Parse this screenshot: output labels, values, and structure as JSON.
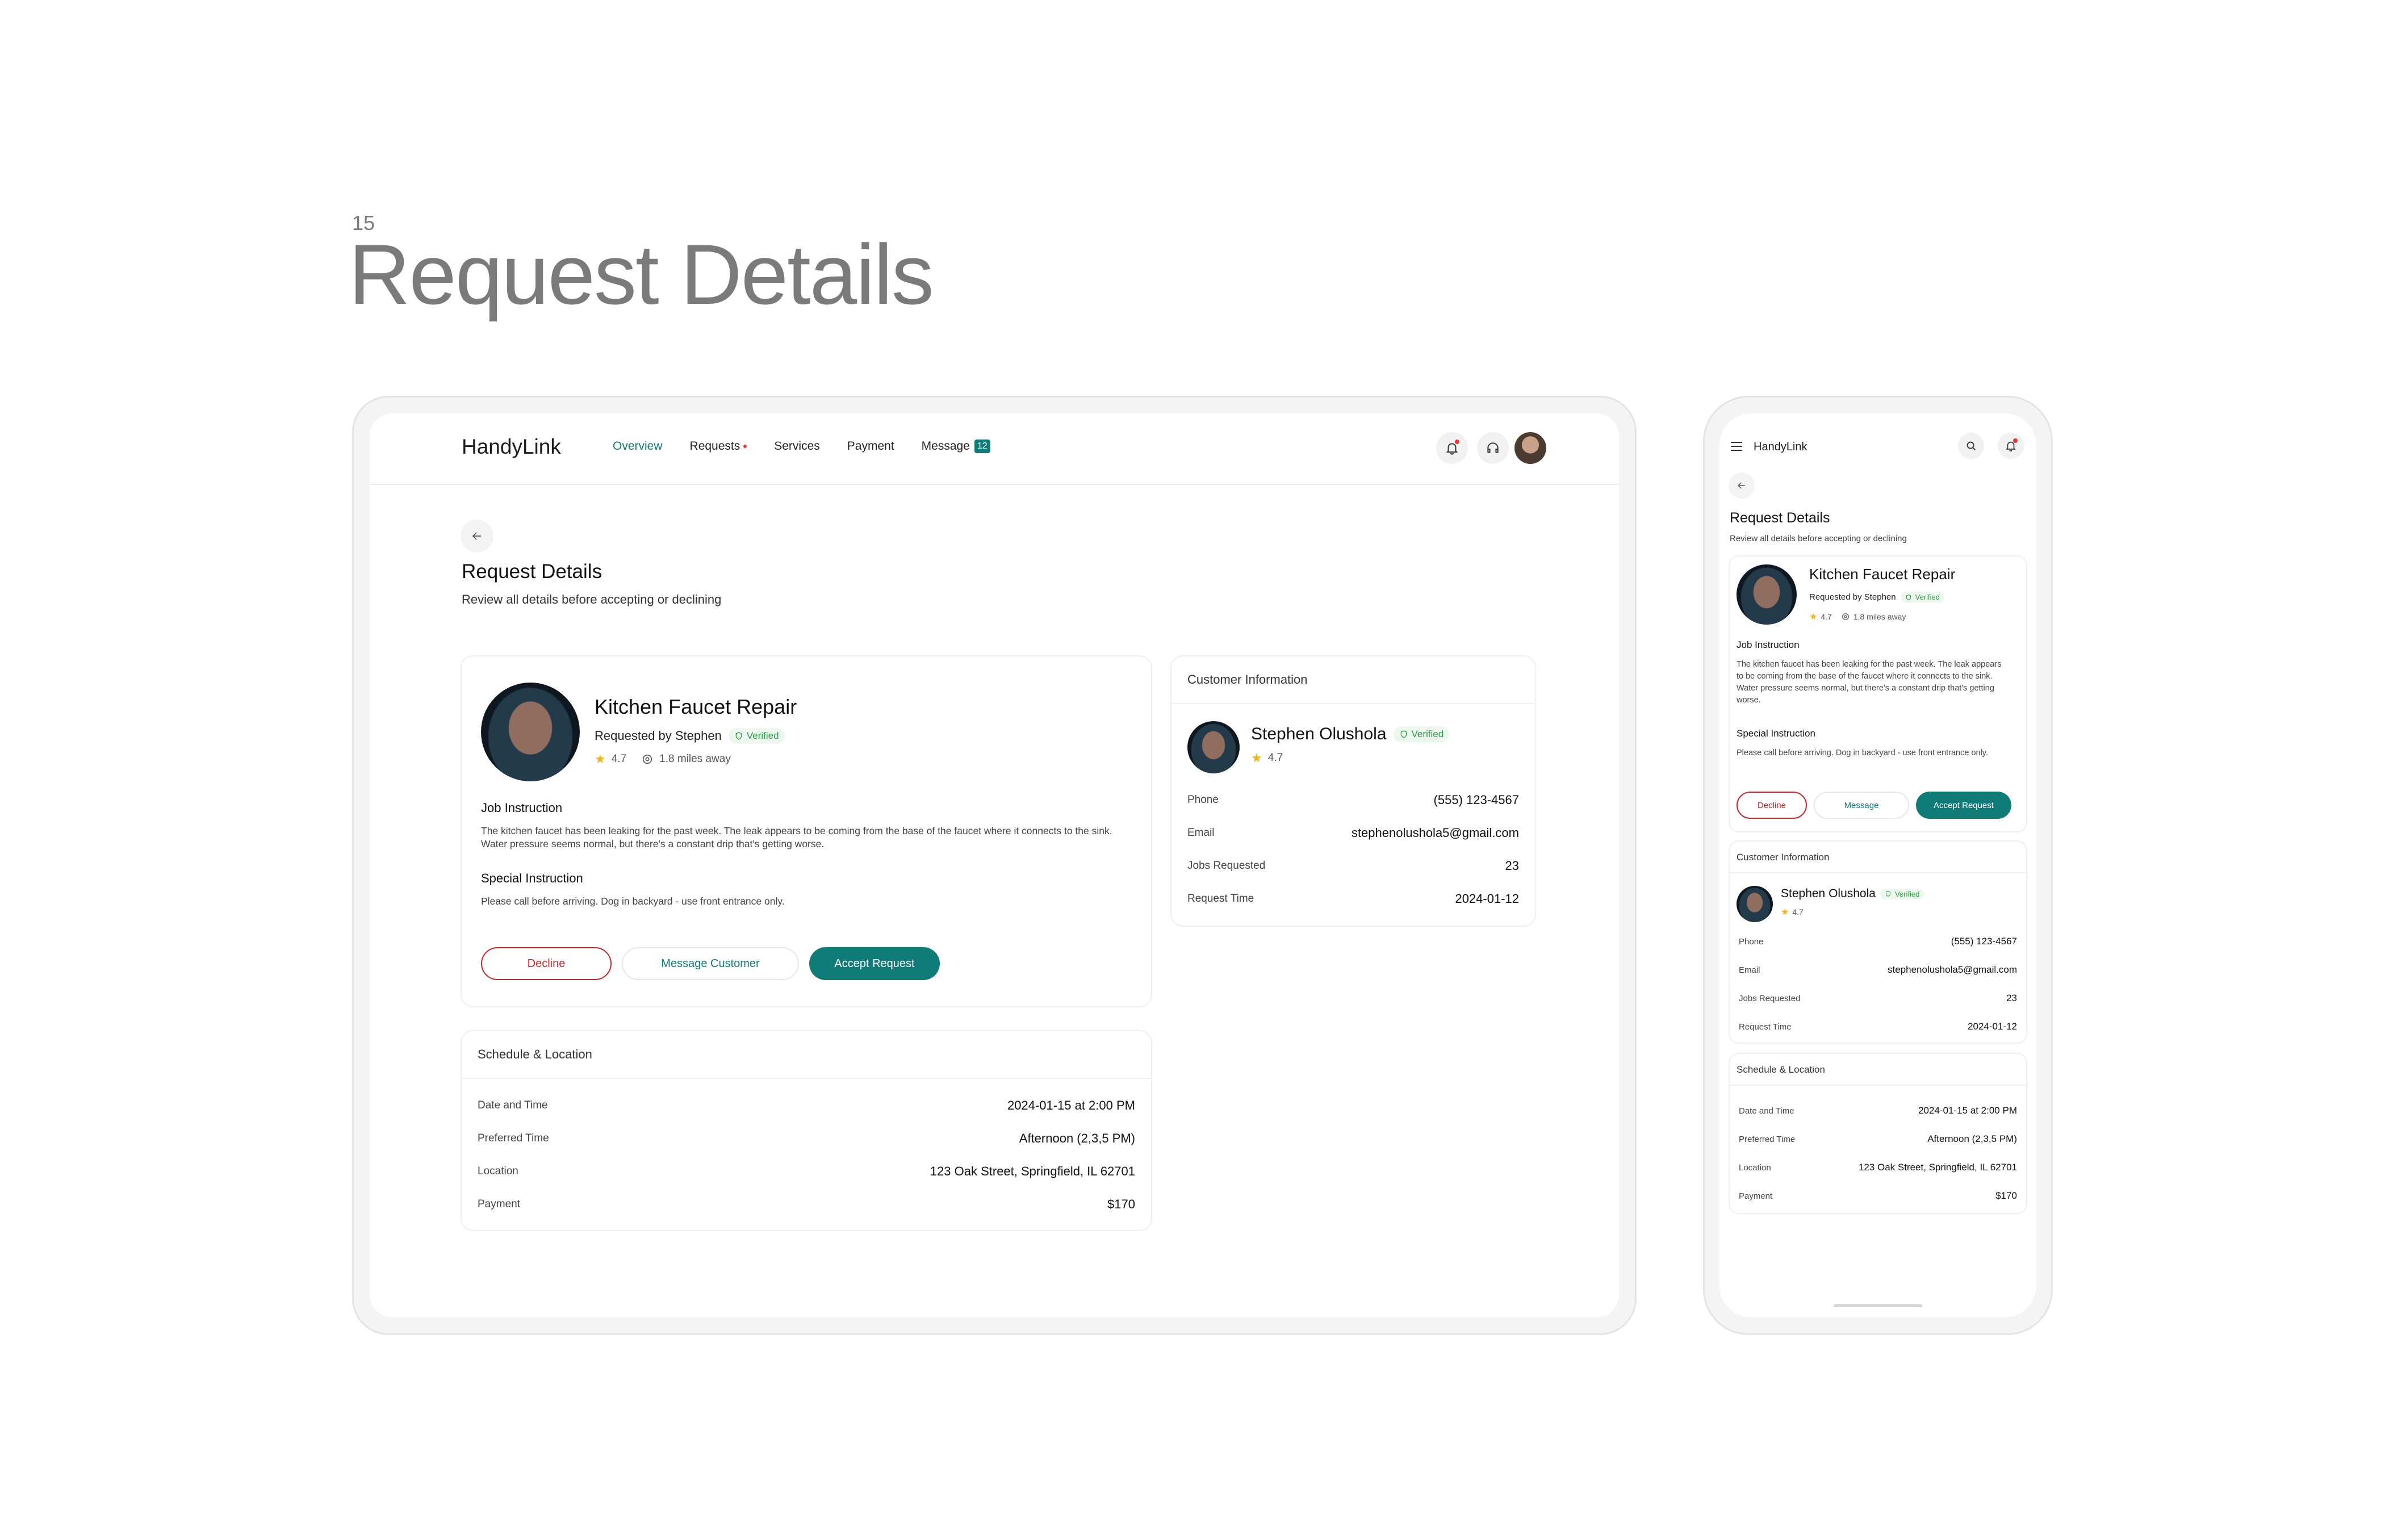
{
  "slide": {
    "number": "15",
    "title": "Request Details"
  },
  "app": {
    "name": "HandyLink"
  },
  "nav": {
    "items": [
      {
        "label": "Overview",
        "active": true
      },
      {
        "label": "Requests",
        "dot": true
      },
      {
        "label": "Services"
      },
      {
        "label": "Payment"
      },
      {
        "label": "Message",
        "badge": "12"
      }
    ]
  },
  "page": {
    "title": "Request Details",
    "subtitle": "Review all details before accepting or declining"
  },
  "request": {
    "title": "Kitchen Faucet Repair",
    "requested_by": "Requested by Stephen",
    "verified": "Verified",
    "rating": "4.7",
    "distance": "1.8 miles away",
    "job_instruction_label": "Job Instruction",
    "job_instruction": "The kitchen faucet has been leaking for the past week. The leak appears to be coming from the base of the faucet where it connects to the sink. Water pressure seems normal, but there's a constant drip that's getting worse.",
    "special_instruction_label": "Special Instruction",
    "special_instruction": "Please call before arriving. Dog in backyard - use front entrance only.",
    "buttons": {
      "decline": "Decline",
      "message_customer": "Message Customer",
      "message": "Message",
      "accept": "Accept Request"
    }
  },
  "customer": {
    "header": "Customer Information",
    "name": "Stephen Olushola",
    "verified": "Verified",
    "rating": "4.7",
    "fields": [
      {
        "label": "Phone",
        "value": "(555) 123-4567"
      },
      {
        "label": "Email",
        "value": "stephenolushola5@gmail.com"
      },
      {
        "label": "Jobs Requested",
        "value": "23"
      },
      {
        "label": "Request Time",
        "value": "2024-01-12"
      }
    ]
  },
  "schedule": {
    "header": "Schedule & Location",
    "fields": [
      {
        "label": "Date and Time",
        "value": "2024-01-15 at 2:00 PM"
      },
      {
        "label": "Preferred Time",
        "value": "Afternoon (2,3,5 PM)"
      },
      {
        "label": "Location",
        "value": "123 Oak Street, Springfield, IL 62701"
      },
      {
        "label": "Payment",
        "value": "$170"
      }
    ]
  },
  "colors": {
    "accent": "#0f7c77",
    "danger": "#c62828",
    "verified": "#2e9b46",
    "star": "#f2b21b"
  }
}
